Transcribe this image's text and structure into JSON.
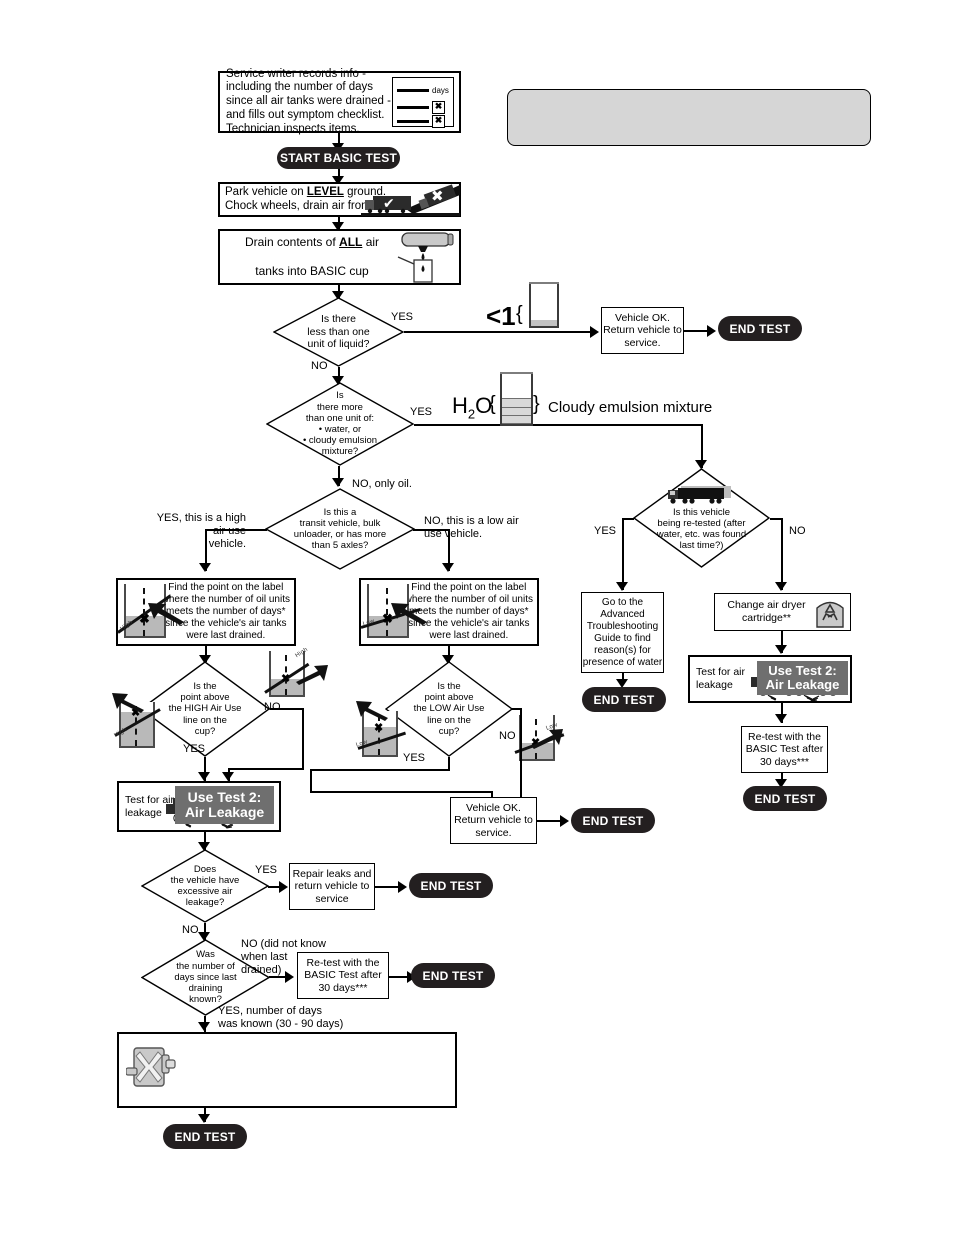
{
  "document": {
    "title": "BASIC Test Flowchart",
    "colors": {
      "ink": "#000000",
      "terminator_fill": "#231f20",
      "terminator_text": "#ffffff",
      "panel_gray": "#d6d6d6",
      "badge_gray": "#6f6f6f",
      "liquid_gray": "#c3c3c3"
    }
  },
  "nodes": {
    "intake": {
      "text": "Service writer records info - including the number of days since all air tanks were drained - and fills out symptom checklist. Technician inspects items.",
      "checklist": {
        "days_label": "days",
        "x_mark": "✖"
      }
    },
    "start": {
      "label": "START BASIC TEST"
    },
    "park": {
      "line1_a": "Park vehicle on ",
      "line1_b": "LEVEL",
      "line1_c": " ground.",
      "line2": "Chock wheels, drain air from system.",
      "check_glyph": "✔",
      "x_glyph": "✖"
    },
    "drain": {
      "line1_a": "Drain contents of ",
      "line1_b": "ALL",
      "line1_c": " air",
      "line2": "tanks into BASIC cup"
    },
    "d_less_than_one": {
      "text": "Is there\nless than one\nunit of liquid?",
      "yes": "YES",
      "no": "NO"
    },
    "lt1_graphic": {
      "label": "<1",
      "brace": "{"
    },
    "vehicle_ok_1": {
      "text": "Vehicle OK.\nReturn vehicle to\nservice."
    },
    "end_test_1": {
      "label": "END TEST"
    },
    "d_water_emulsion": {
      "text": "Is\nthere more\nthan one unit of:\n• water, or\n• cloudy emulsion\nmixture?",
      "yes": "YES",
      "no": "NO, only oil."
    },
    "emulsion_graphic": {
      "h2o": "H",
      "h2o_sub": "2",
      "h2o_tail": "O",
      "left_brace": "{",
      "right_brace": "}",
      "caption": "Cloudy emulsion mixture"
    },
    "d_retested": {
      "text": "Is this vehicle\nbeing re-tested (after\nwater, etc. was found\nlast time?)",
      "yes": "YES",
      "no": "NO"
    },
    "advanced_guide": {
      "text": "Go to the\nAdvanced\nTroubleshooting\nGuide to find\nreason(s) for\npresence of water"
    },
    "end_test_2": {
      "label": "END TEST"
    },
    "change_cartridge": {
      "text": "Change air dryer\ncartridge**"
    },
    "test_air_leak_right": {
      "text": "Test for air\nleakage",
      "badge_line1": "Use Test 2:",
      "badge_line2": "Air Leakage"
    },
    "retest_30_right": {
      "text": "Re-test with the\nBASIC Test after\n30 days***"
    },
    "end_test_3": {
      "label": "END TEST"
    },
    "d_transit": {
      "text": "Is this a\ntransit vehicle, bulk\nunloader, or has more\nthan 5 axles?",
      "yes": "YES, this is a high\nair use\nvehicle.",
      "no": "NO, this is a low air\nuse vehicle."
    },
    "find_point_high": {
      "text": "Find the point on the label\nwhere the number of oil units\nmeets the number  of days*\nsince the vehicle's air tanks\nwere last drained.",
      "slope_label": "High"
    },
    "find_point_low": {
      "text": "Find the point on the label\nwhere the number of oil units\nmeets the number  of days*\nsince the vehicle's air tanks\nwere last drained.",
      "slope_label": "Low"
    },
    "d_high_line": {
      "text": "Is the\npoint above\nthe HIGH Air Use\nline on the\ncup?",
      "yes": "YES",
      "no": "NO",
      "slope_label": "High"
    },
    "d_low_line": {
      "text": "Is the\npoint above\nthe LOW Air Use\nline on the\ncup?",
      "yes": "YES",
      "no": "NO",
      "slope_label": "Low"
    },
    "test_air_leak_left": {
      "text": "Test for air\nleakage",
      "badge_line1": "Use Test 2:",
      "badge_line2": "Air Leakage"
    },
    "vehicle_ok_2": {
      "text": "Vehicle OK.\nReturn vehicle to\nservice."
    },
    "end_test_4": {
      "label": "END TEST"
    },
    "d_excessive_leak": {
      "text": "Does\nthe vehicle have\nexcessive air\nleakage?",
      "yes": "YES",
      "no": "NO"
    },
    "repair_leaks": {
      "text": "Repair leaks and\nreturn vehicle to\nservice"
    },
    "end_test_5": {
      "label": "END TEST"
    },
    "d_days_known": {
      "text": "Was\nthe number of\ndays since last\ndraining\nknown?",
      "no": "NO (did not know\nwhen last\ndrained)",
      "yes": "YES, number of days\nwas known (30 - 90 days)"
    },
    "retest_30_left": {
      "text": "Re-test with the\nBASIC Test after\n30 days***"
    },
    "end_test_6": {
      "label": "END TEST"
    },
    "final_box": {
      "text": ""
    },
    "end_test_7": {
      "label": "END TEST"
    },
    "top_right_panel": {
      "text": ""
    }
  }
}
